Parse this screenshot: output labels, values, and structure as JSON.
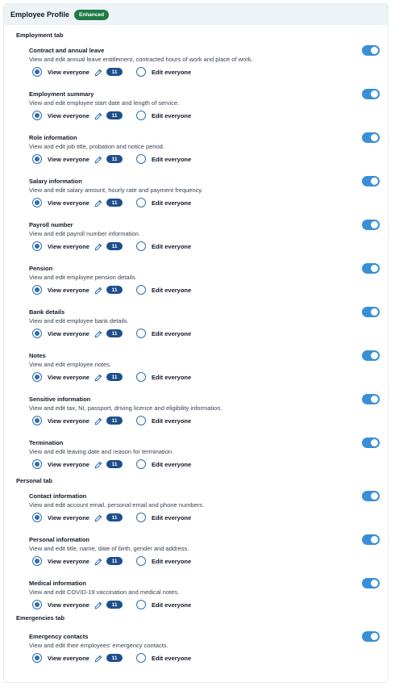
{
  "header": {
    "title": "Employee Profile",
    "badge": "Enhanced"
  },
  "labels": {
    "view": "View everyone",
    "edit": "Edit everyone",
    "count": "11"
  },
  "sections": [
    {
      "title": "Employment tab",
      "items": [
        {
          "title": "Contract and annual leave",
          "desc": "View and edit annual leave entitlement, contracted hours of work and place of work."
        },
        {
          "title": "Employment summary",
          "desc": "View and edit employee start date and length of service."
        },
        {
          "title": "Role information",
          "desc": "View and edit job title, probation and notice period."
        },
        {
          "title": "Salary information",
          "desc": "View and edit salary amount, hourly rate and payment frequency."
        },
        {
          "title": "Payroll number",
          "desc": "View and edit payroll number information."
        },
        {
          "title": "Pension",
          "desc": "View and edit employee pension details."
        },
        {
          "title": "Bank details",
          "desc": "View and edit employee bank details."
        },
        {
          "title": "Notes",
          "desc": "View and edit employee notes."
        },
        {
          "title": "Sensitive information",
          "desc": "View and edit tax, NI, passport, driving licence and eligibility information."
        },
        {
          "title": "Termination",
          "desc": "View and edit leaving date and reason for termination."
        }
      ]
    },
    {
      "title": "Personal tab",
      "items": [
        {
          "title": "Contact information",
          "desc": "View and edit account email, personal email and phone numbers."
        },
        {
          "title": "Personal information",
          "desc": "View and edit title, name, date of birth, gender and address."
        },
        {
          "title": "Medical information",
          "desc": "View and edit COVID-19 vaccination and medical notes."
        }
      ]
    },
    {
      "title": "Emergencies tab",
      "items": [
        {
          "title": "Emergency contacts",
          "desc": "View and edit their employees' emergency contacts."
        }
      ]
    }
  ]
}
